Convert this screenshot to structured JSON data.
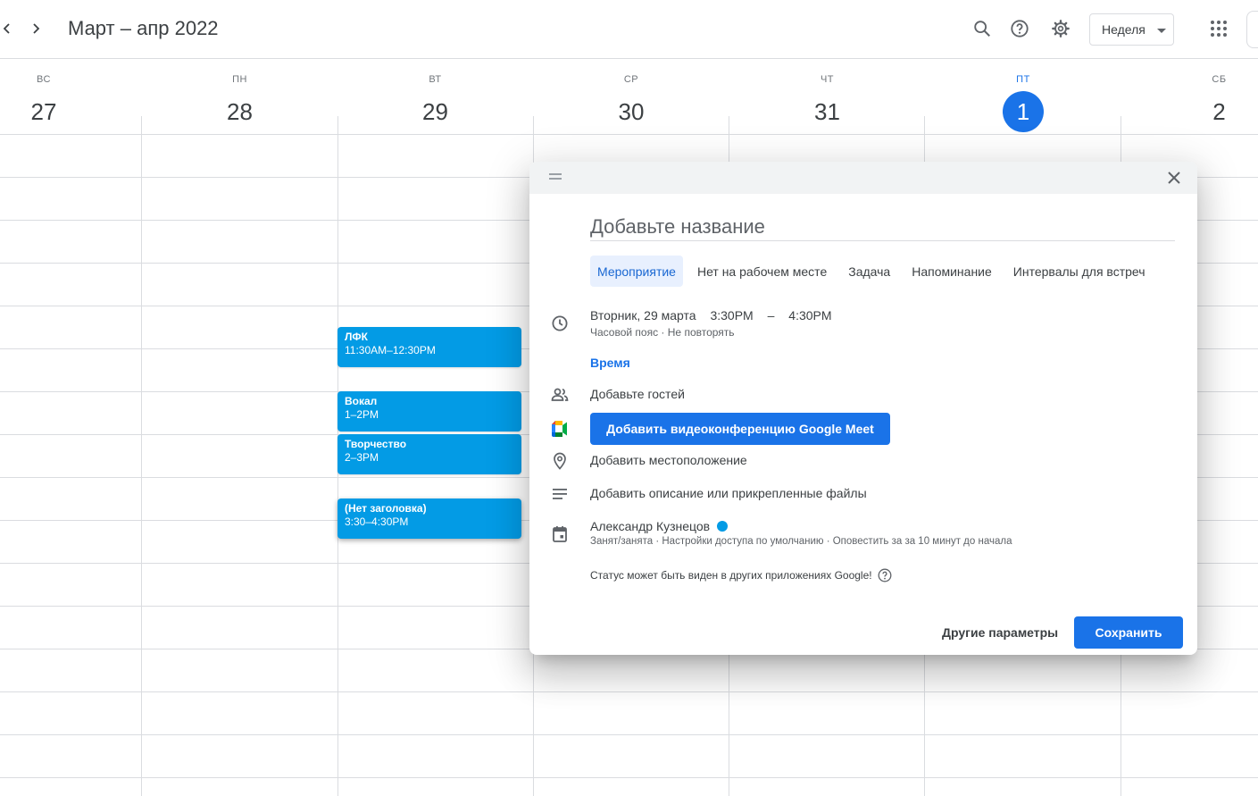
{
  "header": {
    "title": "Март – апр 2022",
    "view_label": "Неделя",
    "icons": [
      "chevron-left-icon",
      "chevron-right-icon",
      "search-icon",
      "help-icon",
      "gear-icon",
      "apps-icon"
    ]
  },
  "days": [
    {
      "name": "ВС",
      "num": "27"
    },
    {
      "name": "ПН",
      "num": "28"
    },
    {
      "name": "ВТ",
      "num": "29"
    },
    {
      "name": "СР",
      "num": "30"
    },
    {
      "name": "ЧТ",
      "num": "31"
    },
    {
      "name": "ПТ",
      "num": "1",
      "today": true
    },
    {
      "name": "СБ",
      "num": "2"
    }
  ],
  "events": [
    {
      "title": "ЛФК",
      "time": "11:30AM–12:30PM"
    },
    {
      "title": "Вокал",
      "time": "1–2PM"
    },
    {
      "title": "Творчество",
      "time": "2–3PM"
    },
    {
      "title": "(Нет заголовка)",
      "time": "3:30–4:30PM"
    }
  ],
  "dialog": {
    "title_placeholder": "Добавьте название",
    "tabs": [
      "Мероприятие",
      "Нет на рабочем месте",
      "Задача",
      "Напоминание",
      "Интервалы для встреч"
    ],
    "selected_tab": "Мероприятие",
    "date": "Вторник, 29 марта",
    "start_time": "3:30PM",
    "dash": "–",
    "end_time": "4:30PM",
    "datetime_sub": "Часовой пояс · Не повторять",
    "time_link": "Время",
    "guests": "Добавьте гостей",
    "meet_button": "Добавить видеоконференцию Google Meet",
    "location": "Добавить местоположение",
    "description": "Добавить описание или прикрепленные файлы",
    "owner": "Александр Кузнецов",
    "owner_color": "#039be5",
    "owner_sub": "Занят/занята · Настройки доступа по умолчанию · Оповестить за за 10 минут до начала",
    "status_note": "Статус может быть виден в других приложениях Google!",
    "more_button": "Другие параметры",
    "save_button": "Сохранить"
  },
  "colors": {
    "accent": "#1a73e8",
    "event": "#039be5",
    "selected_tab_bg": "#e8f0fe"
  }
}
